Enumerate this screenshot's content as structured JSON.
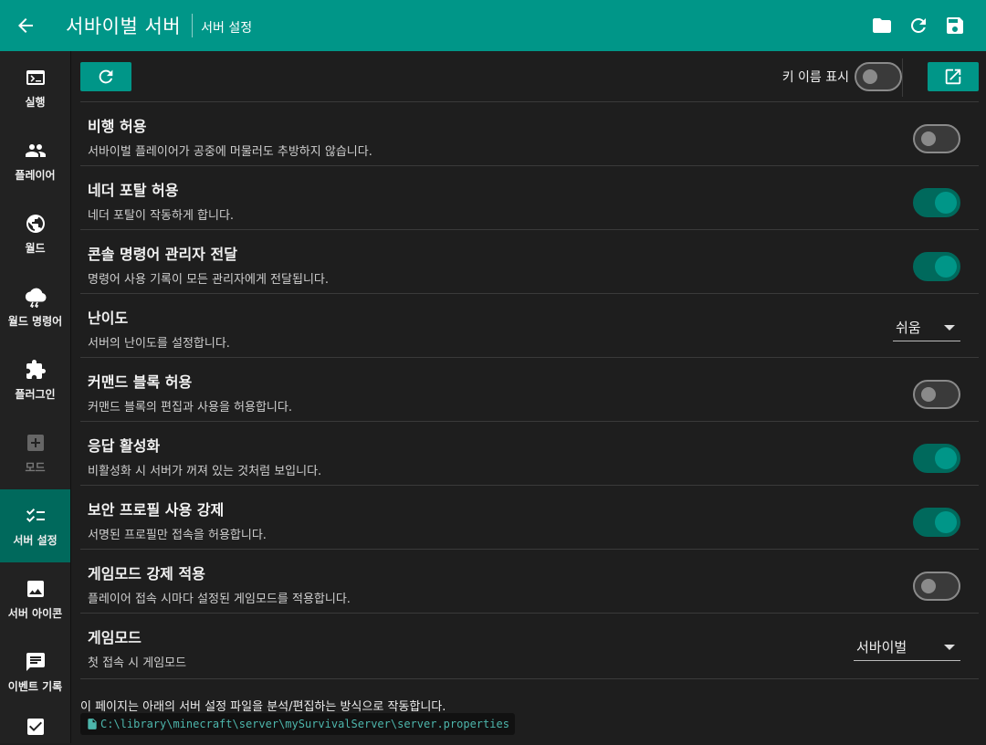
{
  "appbar": {
    "title": "서바이벌 서버",
    "subtitle": "서버 설정",
    "icons": [
      "back-arrow-icon",
      "folder-icon",
      "refresh-icon",
      "save-icon"
    ],
    "color": "#009688"
  },
  "sidebar": {
    "items": [
      {
        "label": "실행",
        "icon": "terminal-icon"
      },
      {
        "label": "플레이어",
        "icon": "people-icon"
      },
      {
        "label": "월드",
        "icon": "globe-icon"
      },
      {
        "label": "월드 명령어",
        "icon": "storm-cloud-icon"
      },
      {
        "label": "플러그인",
        "icon": "puzzle-icon"
      },
      {
        "label": "모드",
        "icon": "plus-box-icon",
        "disabled": true
      },
      {
        "label": "서버 설정",
        "icon": "checklist-icon",
        "active": true
      },
      {
        "label": "서버 아이콘",
        "icon": "image-icon"
      },
      {
        "label": "이벤트 기록",
        "icon": "comment-icon"
      }
    ]
  },
  "toolbar": {
    "key_name_label": "키 이름 표시",
    "key_name_on": false
  },
  "settings": [
    {
      "title": "비행 허용",
      "desc": "서바이벌 플레이어가 공중에 머물러도 추방하지 않습니다.",
      "type": "switch",
      "on": false
    },
    {
      "title": "네더 포탈 허용",
      "desc": "네더 포탈이 작동하게 합니다.",
      "type": "switch",
      "on": true
    },
    {
      "title": "콘솔 명령어 관리자 전달",
      "desc": "명령어 사용 기록이 모든 관리자에게 전달됩니다.",
      "type": "switch",
      "on": true
    },
    {
      "title": "난이도",
      "desc": "서버의 난이도를 설정합니다.",
      "type": "select",
      "value": "쉬움"
    },
    {
      "title": "커맨드 블록 허용",
      "desc": "커맨드 블록의 편집과 사용을 허용합니다.",
      "type": "switch",
      "on": false
    },
    {
      "title": "응답 활성화",
      "desc": "비활성화 시 서버가 꺼져 있는 것처럼 보입니다.",
      "type": "switch",
      "on": true
    },
    {
      "title": "보안 프로필 사용 강제",
      "desc": "서명된 프로필만 접속을 허용합니다.",
      "type": "switch",
      "on": true
    },
    {
      "title": "게임모드 강제 적용",
      "desc": "플레이어 접속 시마다 설정된 게임모드를 적용합니다.",
      "type": "switch",
      "on": false
    },
    {
      "title": "게임모드",
      "desc": "첫 접속 시 게임모드",
      "type": "select",
      "value": "서바이벌"
    }
  ],
  "footer": {
    "note": "이 페이지는 아래의 서버 설정 파일을 분석/편집하는 방식으로 작동합니다.",
    "path": "C:\\library\\minecraft\\server\\mySurvivalServer\\server.properties"
  }
}
